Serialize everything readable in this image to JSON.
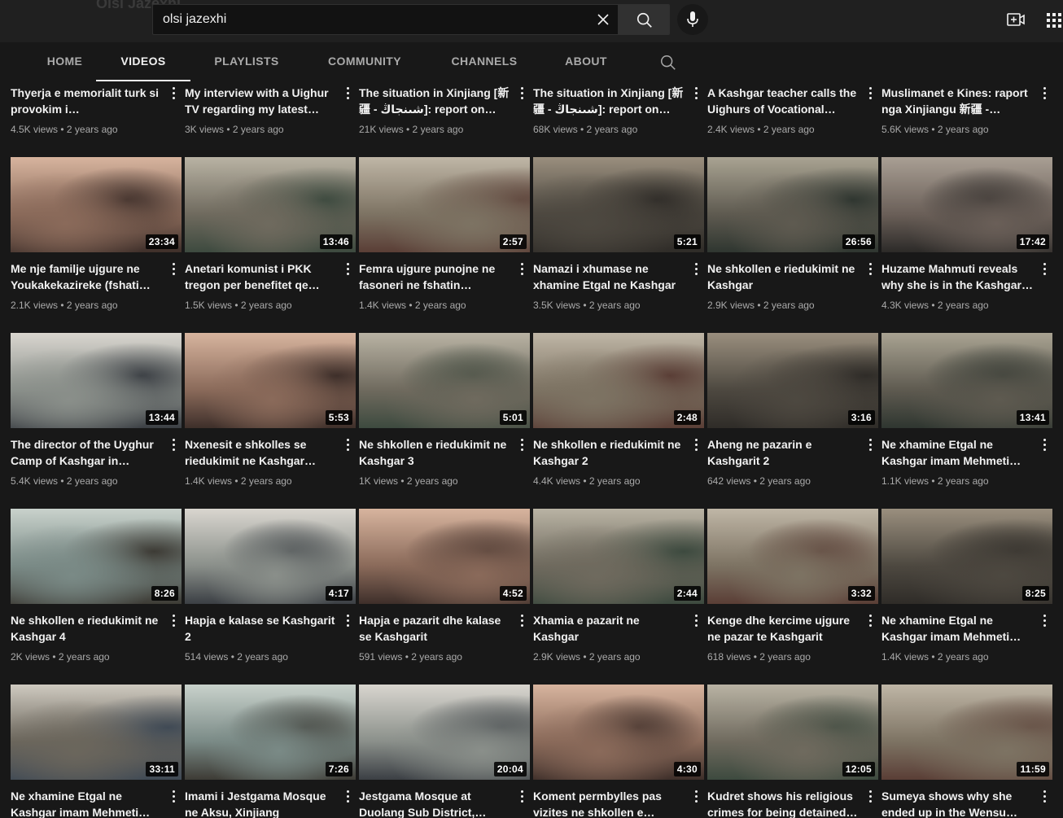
{
  "header": {
    "channel_ghost": "Olsi Jazexhi",
    "search_value": "olsi jazexhi",
    "icons": [
      "close-icon",
      "search-icon",
      "microphone-icon",
      "video-add-icon",
      "apps-grid-icon"
    ]
  },
  "tabs": [
    {
      "label": "HOME"
    },
    {
      "label": "VIDEOS"
    },
    {
      "label": "PLAYLISTS"
    },
    {
      "label": "COMMUNITY"
    },
    {
      "label": "CHANNELS"
    },
    {
      "label": "ABOUT"
    }
  ],
  "videos": [
    {
      "title": "Thyerja e memorialit turk si provokim i…",
      "meta": "4.5K views • 2 years ago",
      "duration": ""
    },
    {
      "title": "My interview with a Uighur TV regarding my latest trip…",
      "meta": "3K views • 2 years ago",
      "duration": ""
    },
    {
      "title": "The situation in Xinjiang [新疆 - شىنجاڭ]: report on my…",
      "meta": "21K views • 2 years ago",
      "duration": ""
    },
    {
      "title": "The situation in Xinjiang [新疆 - شىنجاڭ]: report on my…",
      "meta": "68K views • 2 years ago",
      "duration": ""
    },
    {
      "title": "A Kashgar teacher calls the Uighurs of Vocational…",
      "meta": "2.4K views • 2 years ago",
      "duration": ""
    },
    {
      "title": "Muslimanet e Kines: raport nga Xinjiangu 新疆 - شىنجاڭ…",
      "meta": "5.6K views • 2 years ago",
      "duration": ""
    },
    {
      "title": "Me nje familje ujgure ne Youkakekazireke (fshati nr.…",
      "meta": "2.1K views • 2 years ago",
      "duration": "23:34"
    },
    {
      "title": "Anetari komunist i PKK tregon per benefitet qe…",
      "meta": "1.5K views • 2 years ago",
      "duration": "13:46"
    },
    {
      "title": "Femra ujgure punojne ne fasoneri ne fshatin…",
      "meta": "1.4K views • 2 years ago",
      "duration": "2:57"
    },
    {
      "title": "Namazi i xhumase ne xhamine Etgal ne Kashgar",
      "meta": "3.5K views • 2 years ago",
      "duration": "5:21"
    },
    {
      "title": "Ne shkollen e riedukimit ne Kashgar",
      "meta": "2.9K views • 2 years ago",
      "duration": "26:56"
    },
    {
      "title": "Huzame Mahmuti reveals why she is in the Kashgar…",
      "meta": "4.3K views • 2 years ago",
      "duration": "17:42"
    },
    {
      "title": "The director of the Uyghur Camp of Kashgar in Xinjian…",
      "meta": "5.4K views • 2 years ago",
      "duration": "13:44"
    },
    {
      "title": "Nxenesit e shkolles se riedukimit ne Kashgar…",
      "meta": "1.4K views • 2 years ago",
      "duration": "5:53"
    },
    {
      "title": "Ne shkollen e riedukimit ne Kashgar 3",
      "meta": "1K views • 2 years ago",
      "duration": "5:01"
    },
    {
      "title": "Ne shkollen e riedukimit ne Kashgar 2",
      "meta": "4.4K views • 2 years ago",
      "duration": "2:48"
    },
    {
      "title": "Aheng ne pazarin e Kashgarit 2",
      "meta": "642 views • 2 years ago",
      "duration": "3:16"
    },
    {
      "title": "Ne xhamine Etgal ne Kashgar imam Mehmeti…",
      "meta": "1.1K views • 2 years ago",
      "duration": "13:41"
    },
    {
      "title": "Ne shkollen e riedukimit ne Kashgar 4",
      "meta": "2K views • 2 years ago",
      "duration": "8:26"
    },
    {
      "title": "Hapja e kalase se Kashgarit 2",
      "meta": "514 views • 2 years ago",
      "duration": "4:17"
    },
    {
      "title": "Hapja e pazarit dhe kalase se Kashgarit",
      "meta": "591 views • 2 years ago",
      "duration": "4:52"
    },
    {
      "title": "Xhamia e pazarit ne Kashgar",
      "meta": "2.9K views • 2 years ago",
      "duration": "2:44"
    },
    {
      "title": "Kenge dhe kercime ujgure ne pazar te Kashgarit",
      "meta": "618 views • 2 years ago",
      "duration": "3:32"
    },
    {
      "title": "Ne xhamine Etgal ne Kashgar imam Mehmeti…",
      "meta": "1.4K views • 2 years ago",
      "duration": "8:25"
    },
    {
      "title": "Ne xhamine Etgal ne Kashgar imam Mehmeti…",
      "meta": "",
      "duration": "33:11"
    },
    {
      "title": "Imami i Jestgama Mosque ne Aksu, Xinjiang",
      "meta": "",
      "duration": "7:26"
    },
    {
      "title": "Jestgama Mosque at Duolang Sub District, Aksu,…",
      "meta": "",
      "duration": "20:04"
    },
    {
      "title": "Koment permbylles pas vizites ne shkollen e…",
      "meta": "",
      "duration": "4:30"
    },
    {
      "title": "Kudret shows his religious crimes for being detained i…",
      "meta": "",
      "duration": "12:05"
    },
    {
      "title": "Sumeya shows why she ended up in the Wensu…",
      "meta": "",
      "duration": "11:59"
    }
  ]
}
